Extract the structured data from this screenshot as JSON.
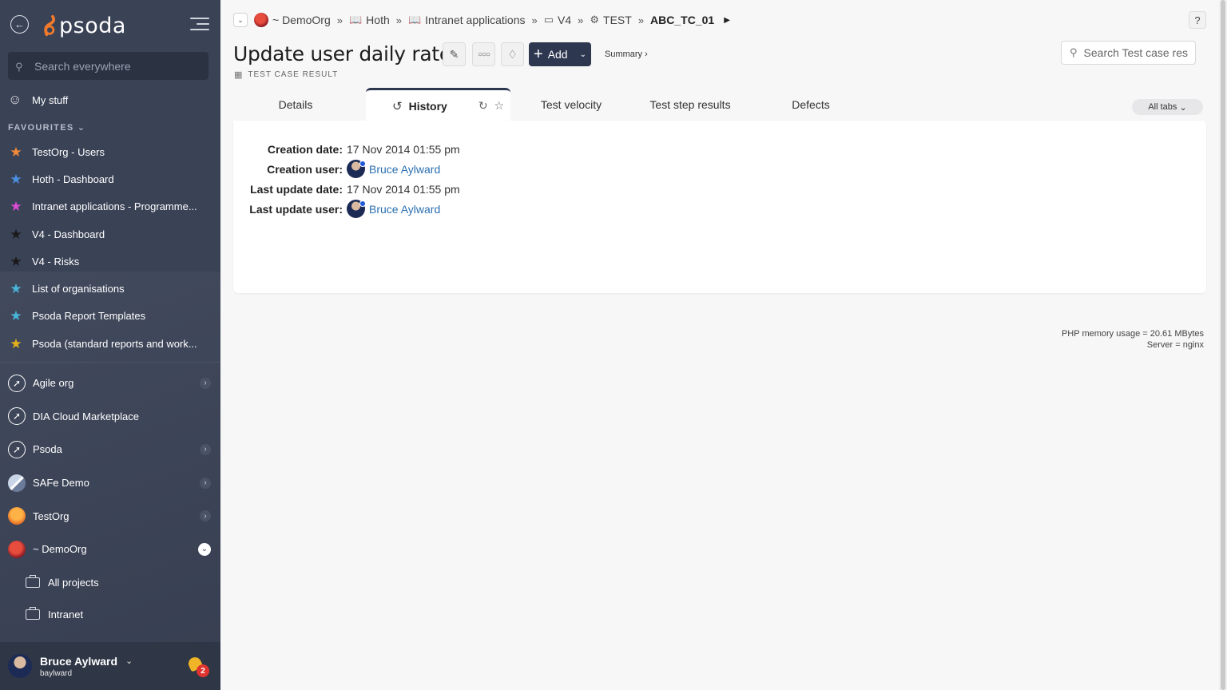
{
  "sidebar": {
    "logo_text": "psoda",
    "search_placeholder": "Search everywhere",
    "my_stuff": "My stuff",
    "favourites_heading": "FAVOURITES",
    "favourites": [
      {
        "label": "TestOrg - Users",
        "color": "#f28a3a"
      },
      {
        "label": "Hoth - Dashboard",
        "color": "#4a8fe0"
      },
      {
        "label": "Intranet applications - Programme...",
        "color": "#d94bd3"
      },
      {
        "label": "V4 - Dashboard",
        "color": "#222222"
      },
      {
        "label": "V4 - Risks",
        "color": "#222222"
      },
      {
        "label": "List of organisations",
        "color": "#46b5d8"
      },
      {
        "label": "Psoda Report Templates",
        "color": "#46b5d8"
      },
      {
        "label": "Psoda (standard reports and work...",
        "color": "#e5b21d"
      }
    ],
    "orgs": [
      {
        "label": "Agile org",
        "icon": "rocket-icon",
        "expandable": true
      },
      {
        "label": "DIA Cloud Marketplace",
        "icon": "rocket-icon",
        "expandable": false
      },
      {
        "label": "Psoda",
        "icon": "rocket-icon",
        "expandable": true
      },
      {
        "label": "SAFe Demo",
        "icon": "mountain-icon",
        "expandable": true
      },
      {
        "label": "TestOrg",
        "icon": "sunset-icon",
        "expandable": true
      },
      {
        "label": "~ DemoOrg",
        "icon": "sunset-icon",
        "expandable": true,
        "open": true
      }
    ],
    "sub_items": [
      {
        "label": "All projects"
      },
      {
        "label": "Intranet"
      }
    ],
    "user": {
      "name": "Bruce Aylward",
      "login": "baylward",
      "notifications": "2"
    }
  },
  "breadcrumbs": [
    {
      "label": "~ DemoOrg",
      "icon": "org-icon"
    },
    {
      "label": "Hoth",
      "icon": "book-icon"
    },
    {
      "label": "Intranet applications",
      "icon": "book-icon"
    },
    {
      "label": "V4",
      "icon": "folder-icon"
    },
    {
      "label": "TEST",
      "icon": "test-icon"
    },
    {
      "label": "ABC_TC_01",
      "icon": "",
      "current": true
    }
  ],
  "header": {
    "title": "Update user daily rate",
    "subtitle": "TEST CASE RESULT",
    "add_label": "Add",
    "summary_label": "Summary ›",
    "search_placeholder": "Search Test case res",
    "help": "?"
  },
  "tabs": [
    {
      "label": "Details"
    },
    {
      "label": "History",
      "active": true
    },
    {
      "label": "Test velocity"
    },
    {
      "label": "Test step results"
    },
    {
      "label": "Defects"
    }
  ],
  "all_tabs_label": "All tabs",
  "history": {
    "creation_date_label": "Creation date:",
    "creation_date": "17 Nov 2014 01:55 pm",
    "creation_user_label": "Creation user:",
    "creation_user": "Bruce Aylward",
    "last_update_date_label": "Last update date:",
    "last_update_date": "17 Nov 2014 01:55 pm",
    "last_update_user_label": "Last update user:",
    "last_update_user": "Bruce Aylward"
  },
  "footer": {
    "memory": "PHP memory usage = 20.61 MBytes",
    "server": "Server = nginx"
  }
}
